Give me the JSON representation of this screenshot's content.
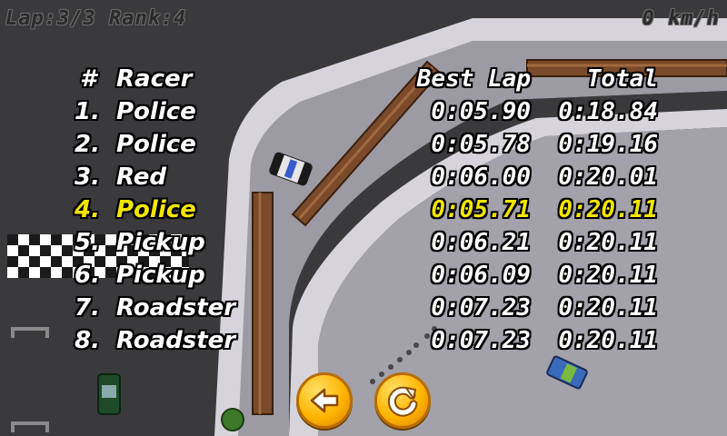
{
  "hud": {
    "lap_rank": "Lap:3/3 Rank:4",
    "speed": "0 km/h"
  },
  "table": {
    "headers": {
      "number": "#",
      "racer": "Racer",
      "best_lap": "Best Lap",
      "total": "Total"
    },
    "rows": [
      {
        "rank": "1.",
        "racer": "Police",
        "best_lap": "0:05.90",
        "total": "0:18.84"
      },
      {
        "rank": "2.",
        "racer": "Police",
        "best_lap": "0:05.78",
        "total": "0:19.16"
      },
      {
        "rank": "3.",
        "racer": "Red",
        "best_lap": "0:06.00",
        "total": "0:20.01"
      },
      {
        "rank": "4.",
        "racer": "Police",
        "best_lap": "0:05.71",
        "total": "0:20.11"
      },
      {
        "rank": "5.",
        "racer": "Pickup",
        "best_lap": "0:06.21",
        "total": "0:20.11"
      },
      {
        "rank": "6.",
        "racer": "Pickup",
        "best_lap": "0:06.09",
        "total": "0:20.11"
      },
      {
        "rank": "7.",
        "racer": "Roadster",
        "best_lap": "0:07.23",
        "total": "0:20.11"
      },
      {
        "rank": "8.",
        "racer": "Roadster",
        "best_lap": "0:07.23",
        "total": "0:20.11"
      }
    ],
    "highlight_row_index": 3,
    "highlight_color": "#f2e600"
  },
  "buttons": {
    "back_icon": "arrow-left-icon",
    "retry_icon": "restart-icon"
  },
  "colors": {
    "background": "#3a3a3c",
    "road": "#9a98a0",
    "curb": "#d8d6dc",
    "log": "#7a4a2a",
    "button": "#ffb400"
  }
}
